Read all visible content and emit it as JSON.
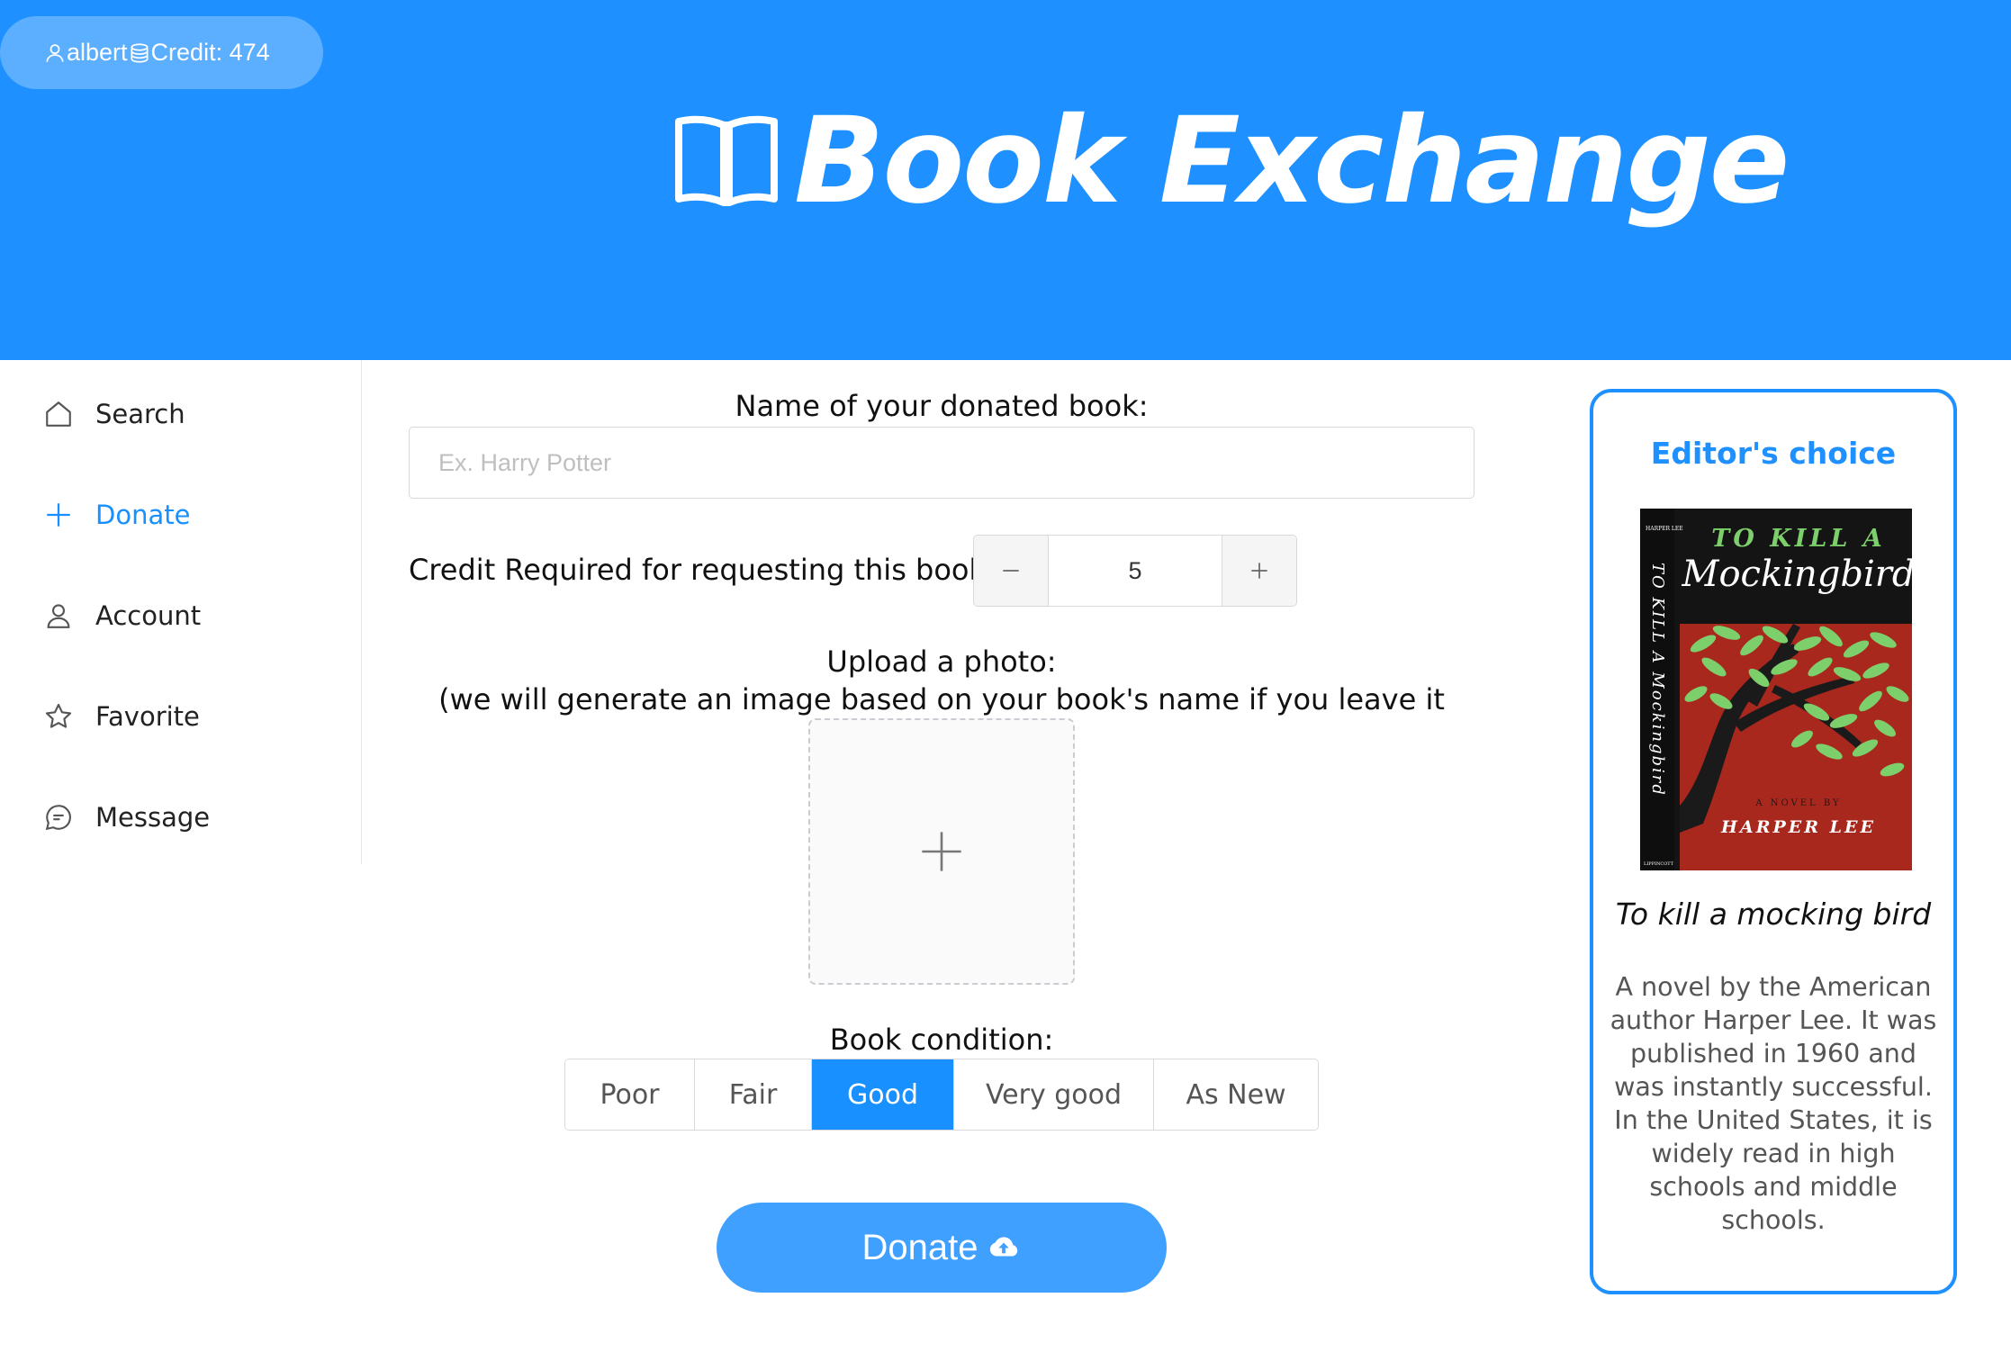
{
  "user": {
    "name": "albert",
    "credit_label": "Credit: 474",
    "user_icon": "user-icon",
    "coin_icon": "coins-icon"
  },
  "header": {
    "title": "Book Exchange",
    "logo_icon": "open-book-icon"
  },
  "sidebar": {
    "items": [
      {
        "label": "Search",
        "icon": "home-icon",
        "active": false
      },
      {
        "label": "Donate",
        "icon": "plus-icon",
        "active": true
      },
      {
        "label": "Account",
        "icon": "user-icon",
        "active": false
      },
      {
        "label": "Favorite",
        "icon": "star-icon",
        "active": false
      },
      {
        "label": "Message",
        "icon": "message-icon",
        "active": false
      }
    ]
  },
  "form": {
    "name_label": "Name of your donated book:",
    "name_placeholder": "Ex. Harry Potter",
    "name_value": "",
    "credit_label": "Credit Required for requesting this book:",
    "credit_value": "5",
    "upload_label": "Upload a photo:",
    "upload_hint": "(we will generate an image based on your book's name if you leave it empty):",
    "condition_label": "Book condition:",
    "conditions": [
      "Poor",
      "Fair",
      "Good",
      "Very good",
      "As New"
    ],
    "selected_condition": "Good",
    "donate_label": "Donate"
  },
  "editor": {
    "title": "Editor's choice",
    "book_name": "To kill a mocking bird",
    "description": "A novel by the American author Harper Lee. It was published in 1960 and was instantly successful. In the United States, it is widely read in high schools and middle schools.",
    "cover": {
      "title_line1": "TO KILL A",
      "title_line2": "Mockingbird",
      "spine_text": "TO KILL A Mockingbird",
      "spine_author": "HARPER LEE",
      "novel_by": "A NOVEL BY",
      "author": "HARPER LEE",
      "publisher": "LIPPINCOTT"
    }
  },
  "colors": {
    "brand": "#1e90ff",
    "accent": "#1890ff",
    "button": "#40a0ff",
    "cover_red": "#a8281e",
    "leaf_green": "#7ccf6a"
  }
}
